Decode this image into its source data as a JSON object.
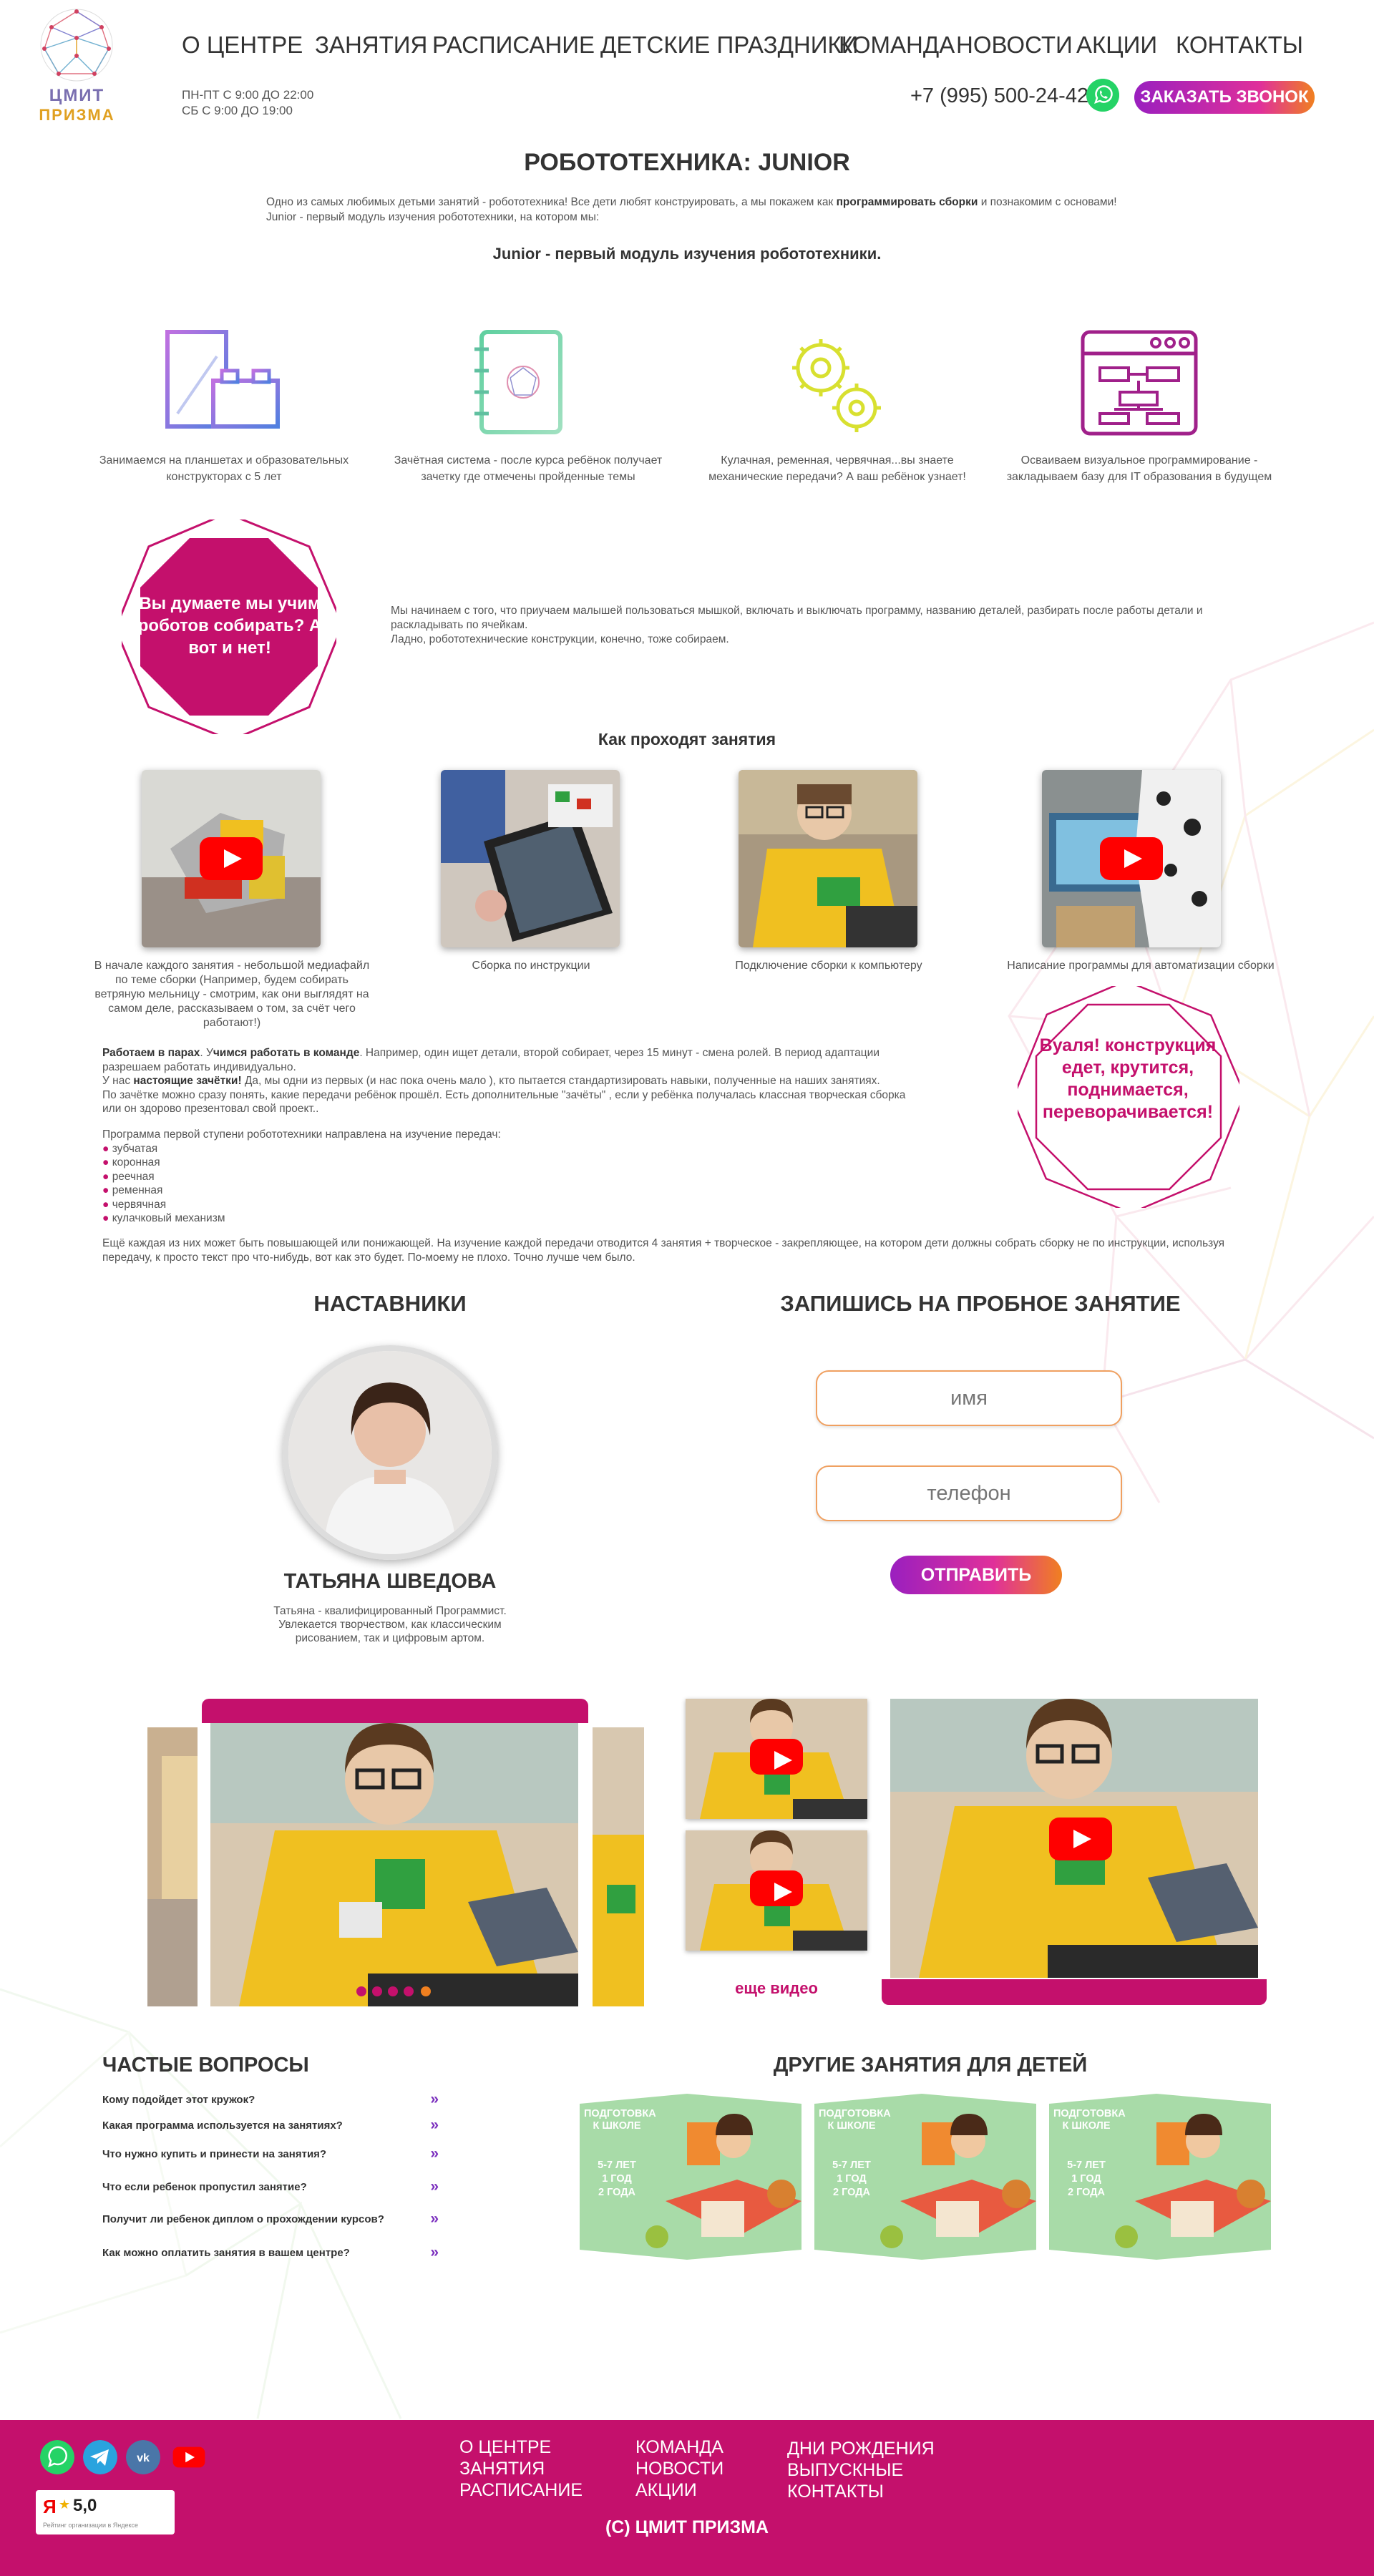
{
  "brand": {
    "line1": "ЦМИТ",
    "line2": "ПРИЗМА"
  },
  "nav": [
    "О ЦЕНТРЕ",
    "ЗАНЯТИЯ",
    "РАСПИСАНИЕ",
    "ДЕТСКИЕ ПРАЗДНИКИ",
    "КОМАНДА",
    "НОВОСТИ",
    "АКЦИИ",
    "КОНТАКТЫ"
  ],
  "hours": {
    "weekdays": "ПН-ПТ С 9:00 ДО 22:00",
    "saturday": "СБ С 9:00 ДО 19:00"
  },
  "phone": "+7 (995) 500-24-42",
  "call_button": "ЗАКАЗАТЬ ЗВОНОК",
  "page_title": "РОБОТОТЕХНИКА: JUNIOR",
  "intro": {
    "part1": "Одно из самых любимых детьми занятий - робототехника! Все дети любят конструировать, а мы покажем как ",
    "bold": "программировать сборки",
    "part2": " и познакомим с основами!",
    "line2": "Junior - первый модуль изучения робототехники, на котором мы:"
  },
  "subheading": "Junior - первый модуль изучения робототехники.",
  "features": [
    {
      "icon": "tablet-blocks-icon",
      "text": "Занимаемся на планшетах и  образовательных конструкторах с 5 лет"
    },
    {
      "icon": "notebook-icon",
      "text": "Зачётная система - после курса ребёнок получает зачетку где отмечены пройденные темы"
    },
    {
      "icon": "gears-icon",
      "text": "Кулачная, ременная, червячная...вы знаете механические передачи? А ваш ребёнок узнает!"
    },
    {
      "icon": "visual-programming-icon",
      "text": "Осваиваем визуальное программирование - закладываем базу для IT образования в будущем"
    }
  ],
  "octagon1": "Вы думаете мы учим роботов собирать? А вот и нет!",
  "begin_text": {
    "line1": "Мы начинаем с того, что приучаем малышей пользоваться мышкой, включать и выключать программу, названию деталей, разбирать после работы детали и раскладывать по ячейкам.",
    "line2": "Ладно, робототехнические конструкции, конечно, тоже собираем."
  },
  "how_title": "Как проходят занятия",
  "lesson_steps": [
    "В начале каждого занятия - небольшой медиафайл по теме сборки (Например, будем собирать ветряную мельницу - смотрим, как они выглядят на самом деле, рассказываем о том, за счёт чего работают!)",
    "Сборка по инструкции",
    "Подключение сборки к компьютеру",
    "Написание программы для автоматизации сборки"
  ],
  "pairs": {
    "b1": "Работаем в парах",
    "t1": ". У",
    "b2": "чимся работать в команде",
    "t2": ". Например, один ищет детали, второй собирает, через 15 минут - смена ролей. В период адаптации разрешаем работать индивидуально.",
    "t3": "У нас ",
    "b3": "настоящие зачётки!",
    "t4": " Да, мы одни из первых (и нас пока очень мало ), кто пытается стандартизировать навыки, полученные на наших занятиях.",
    "t5": "По зачётке можно сразу понять, какие передачи ребёнок прошёл. Есть дополнительные \"зачёты\" , если у ребёнка получалась классная творческая сборка или он здорово презентовал свой проект.."
  },
  "program_intro": "Программа первой ступени робототехники направлена на изучение передач:",
  "gears_list": [
    "зубчатая",
    "коронная",
    "реечная",
    "ременная",
    "червячная",
    "кулачковый механизм"
  ],
  "octagon2": "Вуаля! конструкция едет, крутится, поднимается, переворачивается!",
  "bottom_text": "Ещё каждая из них может быть повышающей или понижающей. На изучение каждой передачи отводится 4 занятия + творческое - закрепляющее, на котором дети должны собрать сборку не по инструкции, используя передачу, к просто  текст про что-нибудь, вот как это будет. По-моему не плохо. Точно лучше чем было.",
  "mentors_title": "НАСТАВНИКИ",
  "mentor": {
    "name": "ТАТЬЯНА ШВЕДОВА",
    "desc": "Татьяна - квалифицированный Программист. Увлекается творчеством, как классическим рисованием, так и цифровым артом."
  },
  "signup": {
    "title": "ЗАПИШИСЬ НА ПРОБНОЕ ЗАНЯТИЕ",
    "name_placeholder": "имя",
    "phone_placeholder": "телефон",
    "submit": "ОТПРАВИТЬ"
  },
  "more_video": "еще видео",
  "faq_title": "ЧАСТЫЕ ВОПРОСЫ",
  "faq": [
    "Кому подойдет этот кружок?",
    "Какая программа используется на занятиях?",
    "Что нужно купить и принести на занятия?",
    "Что если ребенок пропустил занятие?",
    "Получит ли ребенок диплом о прохождении курсов?",
    "Как можно оплатить занятия в вашем центре?"
  ],
  "other_title": "ДРУГИЕ ЗАНЯТИЯ ДЛЯ ДЕТЕЙ",
  "cards": [
    {
      "title": "ПОДГОТОВКА К ШКОЛЕ",
      "age": "5-7 ЛЕТ",
      "duration": "1 ГОД",
      "hours": "2 ГОДА"
    },
    {
      "title": "ПОДГОТОВКА К ШКОЛЕ",
      "age": "5-7 ЛЕТ",
      "duration": "1 ГОД",
      "hours": "2 ГОДА"
    },
    {
      "title": "ПОДГОТОВКА К ШКОЛЕ",
      "age": "5-7 ЛЕТ",
      "duration": "1 ГОД",
      "hours": "2 ГОДА"
    }
  ],
  "footer": {
    "col1": [
      "О ЦЕНТРЕ",
      "ЗАНЯТИЯ",
      "РАСПИСАНИЕ"
    ],
    "col2": [
      "КОМАНДА",
      "НОВОСТИ",
      "АКЦИИ"
    ],
    "col3": [
      "ДНИ РОЖДЕНИЯ",
      "ВЫПУСКНЫЕ",
      "КОНТАКТЫ"
    ],
    "copyright": "(С) ЦМИТ ПРИЗМА",
    "rating": "5,0",
    "rating_note": "Рейтинг организации в Яндексе"
  },
  "colors": {
    "brand": "#c4106c",
    "accent_purple": "#7b2fbe",
    "card_green": "#a8dba8",
    "whatsapp": "#25d366"
  }
}
